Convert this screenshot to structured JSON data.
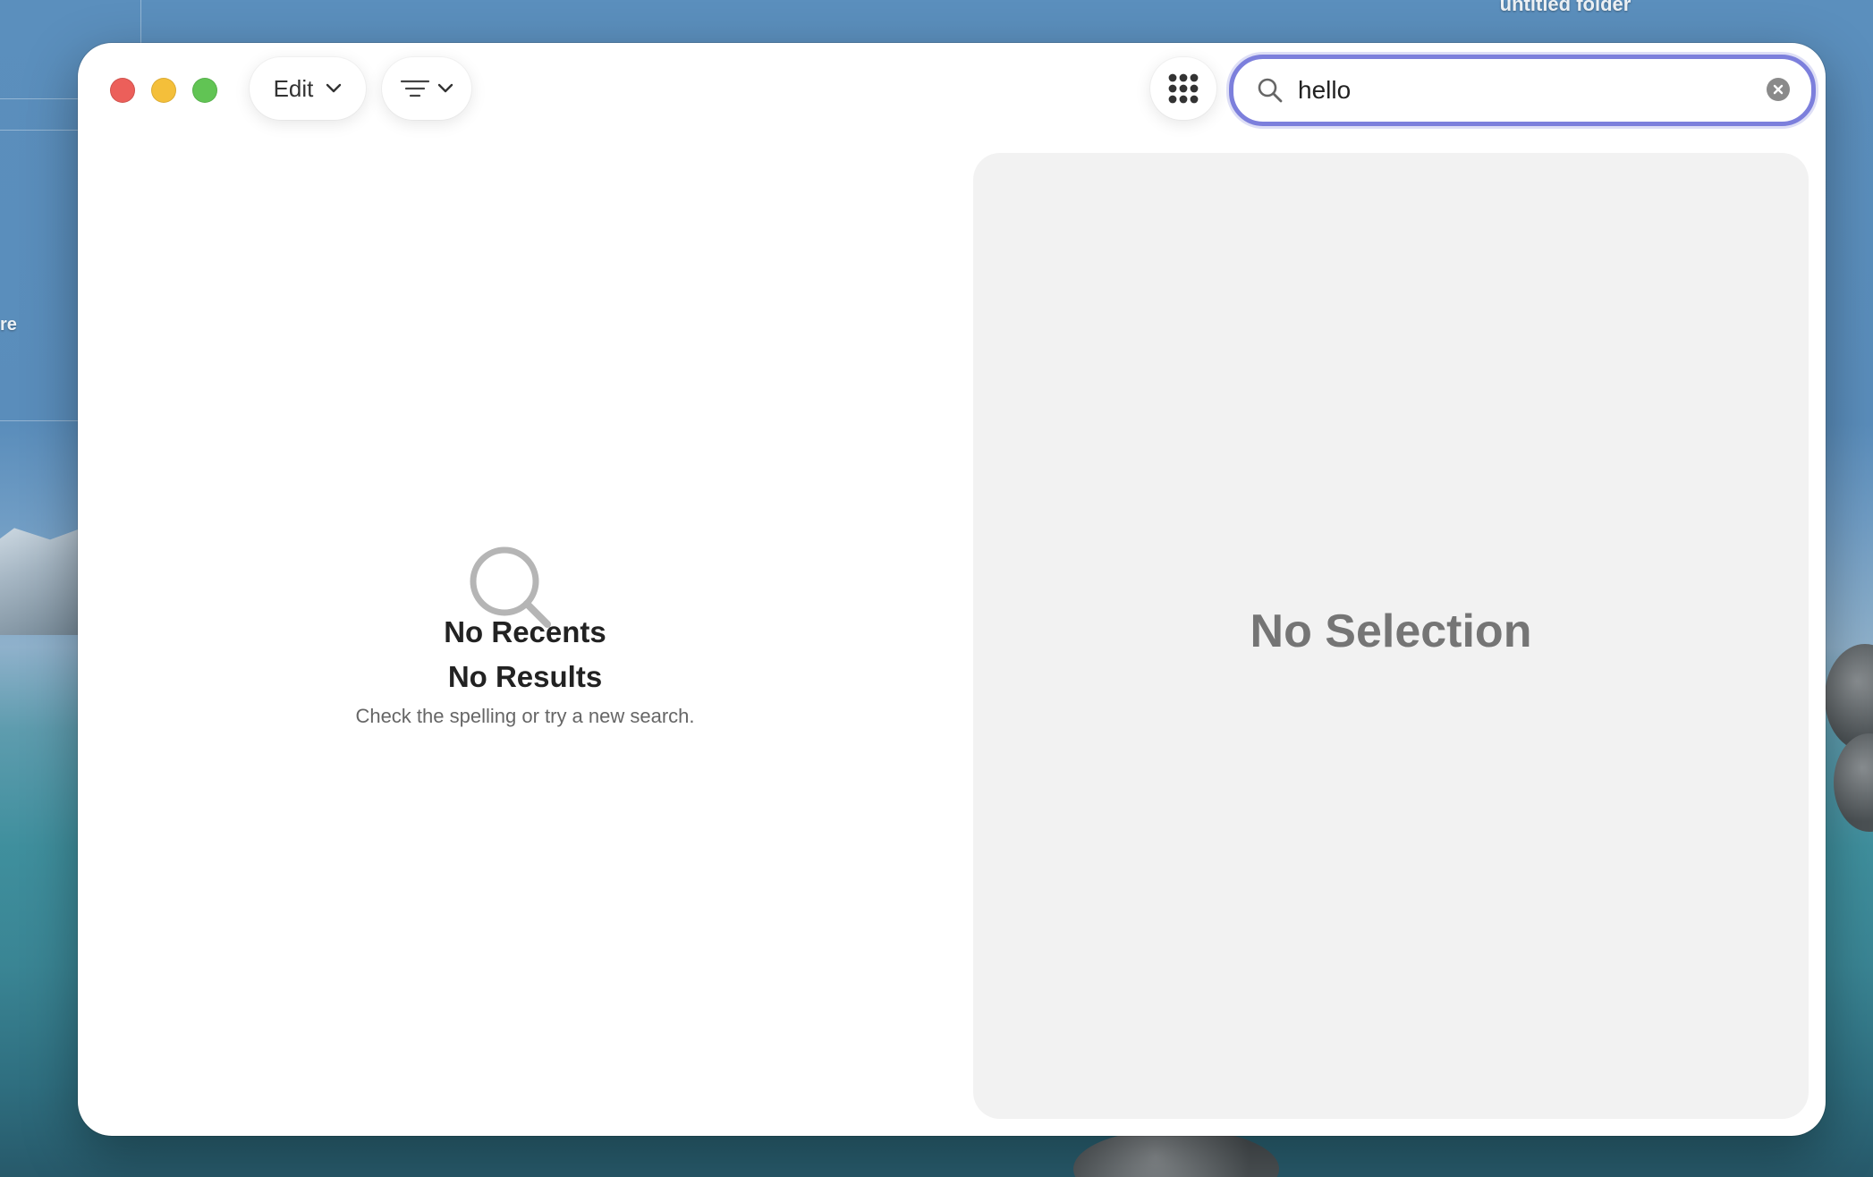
{
  "desktop": {
    "folder_label": "untitled folder",
    "side_label": "re"
  },
  "toolbar": {
    "edit_label": "Edit",
    "sort_icon": "lines-filter-icon",
    "apps_icon": "grid-dots-icon"
  },
  "search": {
    "value": "hello",
    "icon": "search-icon",
    "clear_icon": "clear-icon"
  },
  "list": {
    "empty_title": "No Recents",
    "results_title": "No Results",
    "hint": "Check the spelling or try a new search."
  },
  "detail": {
    "empty_label": "No Selection"
  },
  "colors": {
    "accent": "#7c7fdc",
    "close": "#ec5f5a",
    "minimize": "#f4bf3a",
    "zoom": "#61c454"
  }
}
